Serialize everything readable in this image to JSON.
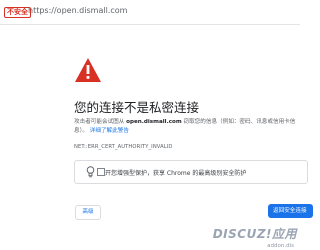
{
  "address_bar": {
    "security_label": "不安全",
    "url": "https://open.dismall.com"
  },
  "error": {
    "icon": "warning-triangle-icon",
    "title": "您的连接不是私密连接",
    "desc_prefix": "攻击者可能会试图从",
    "domain": "open.dismall.com",
    "desc_middle": "窃取您的信息（例如：密码、讯息或信用卡信息）。",
    "learn_more": "详细了解此警告",
    "error_code": "NET::ERR_CERT_AUTHORITY_INVALID"
  },
  "safe_browsing": {
    "icon": "lightbulb-icon",
    "text": "开您增强型保护，获享 Chrome 的最高级别安全防护"
  },
  "buttons": {
    "advanced": "高级",
    "back_to_safety": "返回安全连接"
  },
  "watermark": {
    "brand": "DISCUZ!应用",
    "sub": "addon.dis"
  },
  "colors": {
    "warning_red": "#d93025",
    "link_blue": "#1a73e8",
    "primary_button": "#1a73e8"
  }
}
